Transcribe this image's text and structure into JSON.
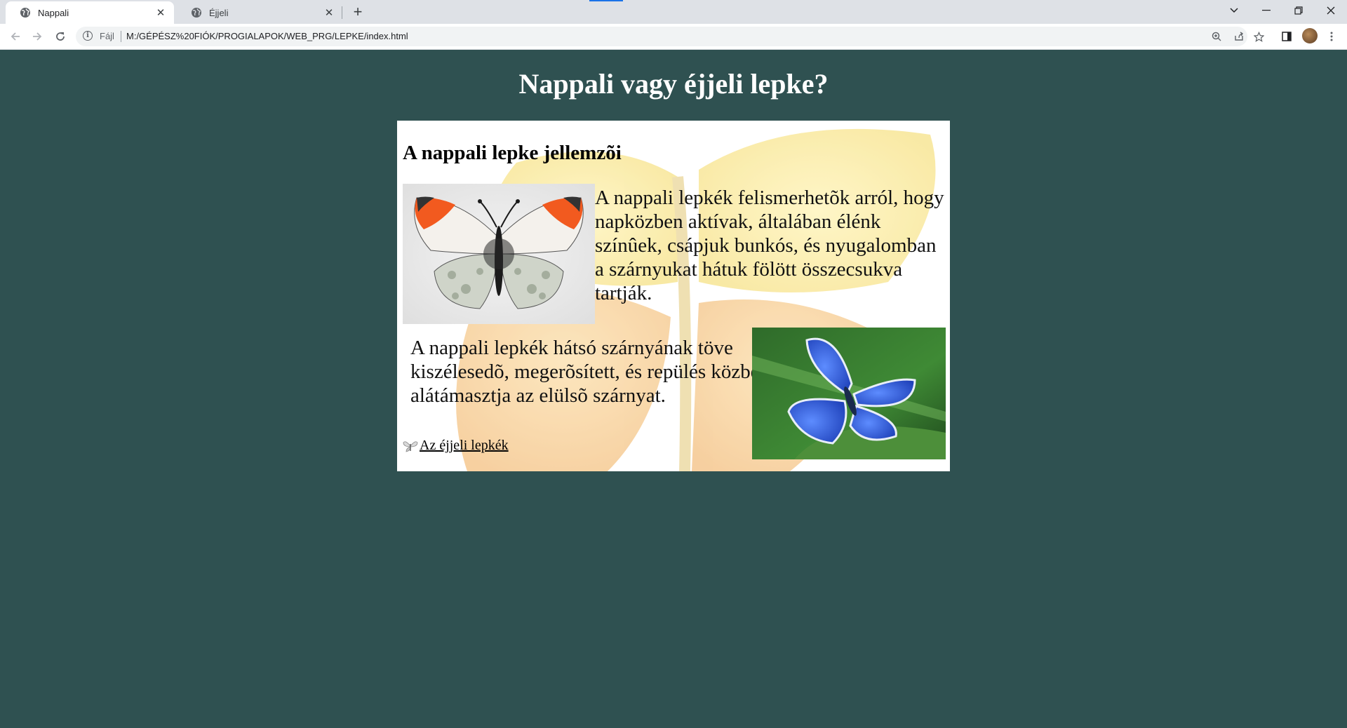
{
  "browser": {
    "tabs": [
      {
        "title": "Nappali",
        "active": true
      },
      {
        "title": "Éjjeli",
        "active": false
      }
    ],
    "address": {
      "scheme_label": "Fájl",
      "url": "M:/GÉPÉSZ%20FIÓK/PROGIALAPOK/WEB_PRG/LEPKE/index.html"
    },
    "icons": [
      "globe-icon",
      "close-icon",
      "new-tab-icon",
      "back-icon",
      "forward-icon",
      "reload-icon",
      "info-icon",
      "zoom-icon",
      "share-icon",
      "bookmark-star-icon",
      "side-panel-icon",
      "menu-icon",
      "minimize-icon",
      "restore-icon",
      "close-window-icon",
      "tab-search-icon"
    ]
  },
  "page": {
    "title": "Nappali vagy éjjeli lepke?",
    "section_heading": "A nappali lepke jellemzõi",
    "paragraph1": "A nappali lepkék felismerhetõk arról, hogy napközben aktívak, általában élénk színûek, csápjuk bunkós, és nyugalomban a szárnyukat hátuk fölött összecsukva tartják.",
    "paragraph2": "A nappali lepkék hátsó szárnyának töve kiszélesedõ, megerõsített, és repülés közben alátámasztja az elülsõ szárnyat.",
    "link_text": "Az éjjeli lepkék",
    "colors": {
      "page_background": "#2f5151",
      "card_background": "#ffffff",
      "title_color": "#ffffff"
    }
  }
}
